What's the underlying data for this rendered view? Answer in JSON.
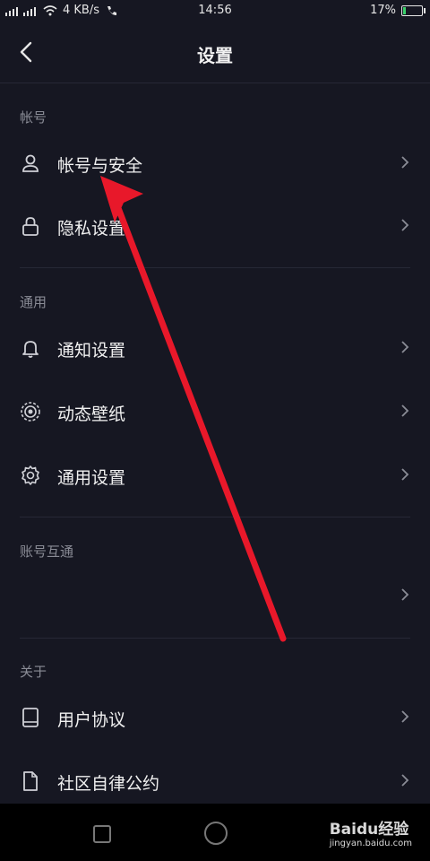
{
  "status_bar": {
    "network_speed": "4 KB/s",
    "time": "14:56",
    "battery": "17%",
    "battery_level": 0.17
  },
  "header": {
    "title": "设置"
  },
  "sections": [
    {
      "title": "帐号",
      "items": [
        {
          "label": "帐号与安全",
          "icon": "user-icon"
        },
        {
          "label": "隐私设置",
          "icon": "lock-icon"
        }
      ]
    },
    {
      "title": "通用",
      "items": [
        {
          "label": "通知设置",
          "icon": "bell-icon"
        },
        {
          "label": "动态壁纸",
          "icon": "wallpaper-icon"
        },
        {
          "label": "通用设置",
          "icon": "gear-icon"
        }
      ]
    },
    {
      "title": "账号互通",
      "items": [
        {
          "label": "",
          "icon": ""
        }
      ]
    },
    {
      "title": "关于",
      "items": [
        {
          "label": "用户协议",
          "icon": "book-icon"
        },
        {
          "label": "社区自律公约",
          "icon": "document-icon"
        }
      ]
    }
  ],
  "watermark": {
    "brand": "Baidu经验",
    "url": "jingyan.baidu.com"
  },
  "colors": {
    "background": "#161722",
    "arrow": "#e8182a",
    "text": "#f0f0f0",
    "muted": "#8a8c96"
  }
}
